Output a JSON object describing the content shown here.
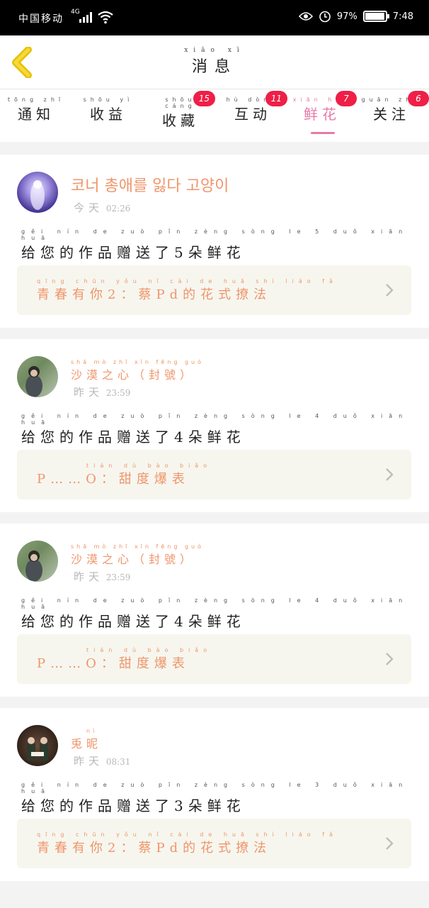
{
  "status_bar": {
    "carrier": "中国移动",
    "network": "4G",
    "battery": "97%",
    "battery_level": 0.97,
    "time": "7:48"
  },
  "header": {
    "title_pinyin": "xiāo xī",
    "title": "消息"
  },
  "tabs": [
    {
      "pinyin": "tōng zhī",
      "label": "通知",
      "badge": "",
      "active": false
    },
    {
      "pinyin": "shōu yì",
      "label": "收益",
      "badge": "",
      "active": false
    },
    {
      "pinyin": "shōu cáng",
      "label": "收藏",
      "badge": "15",
      "active": false
    },
    {
      "pinyin": "hù dòng",
      "label": "互动",
      "badge": "11",
      "active": false
    },
    {
      "pinyin": "xiān huā",
      "label": "鲜花",
      "badge": "7",
      "active": true
    },
    {
      "pinyin": "guān zhù",
      "label": "关注",
      "badge": "6",
      "active": false
    }
  ],
  "messages": [
    {
      "username": "코너 총애를 잃다 고양이",
      "username_pinyin": "",
      "date_pinyin": "",
      "date": "今天",
      "time": "02:26",
      "message_pinyin": "gěi nín de zuò pǐn zèng sòng le 5 duǒ xiān huā",
      "message": "给您的作品赠送了5朵鲜花",
      "work_pinyin": "qīng chūn yǒu nǐ  cài  de huā shì liáo fǎ",
      "work": "青春有你2：蔡Pd的花式撩法"
    },
    {
      "username": "沙漠之心（封號）",
      "username_pinyin": "shā mò zhī xīn  fēng guó",
      "date_pinyin": "",
      "date": "昨天",
      "time": "23:59",
      "message_pinyin": "gěi nín de zuò pǐn zèng sòng le 4 duǒ xiān huā",
      "message": "给您的作品赠送了4朵鲜花",
      "work_pinyin": "tián dù bào biǎo",
      "work": "P……O：甜度爆表"
    },
    {
      "username": "沙漠之心（封號）",
      "username_pinyin": "shā mò zhī xīn  fēng guó",
      "date_pinyin": "",
      "date": "昨天",
      "time": "23:59",
      "message_pinyin": "gěi nín de zuò pǐn zèng sòng le 4 duǒ xiān huā",
      "message": "给您的作品赠送了4朵鲜花",
      "work_pinyin": "tián dù bào biǎo",
      "work": "P……O：甜度爆表"
    },
    {
      "username": "兎昵",
      "username_pinyin": "nì",
      "date_pinyin": "",
      "date": "昨天",
      "time": "08:31",
      "message_pinyin": "gěi nín de zuò pǐn zèng sòng le 3 duǒ xiān huā",
      "message": "给您的作品赠送了3朵鲜花",
      "work_pinyin": "qīng chūn yǒu nǐ  cài  de huā shì liáo fǎ",
      "work": "青春有你2：蔡Pd的花式撩法"
    }
  ],
  "icons": {
    "back": "chevron-left-icon",
    "work_arrow": "chevron-right-icon",
    "accent_color": "#e87aa8",
    "name_color": "#f0956a",
    "badge_color": "#ef1f47"
  }
}
